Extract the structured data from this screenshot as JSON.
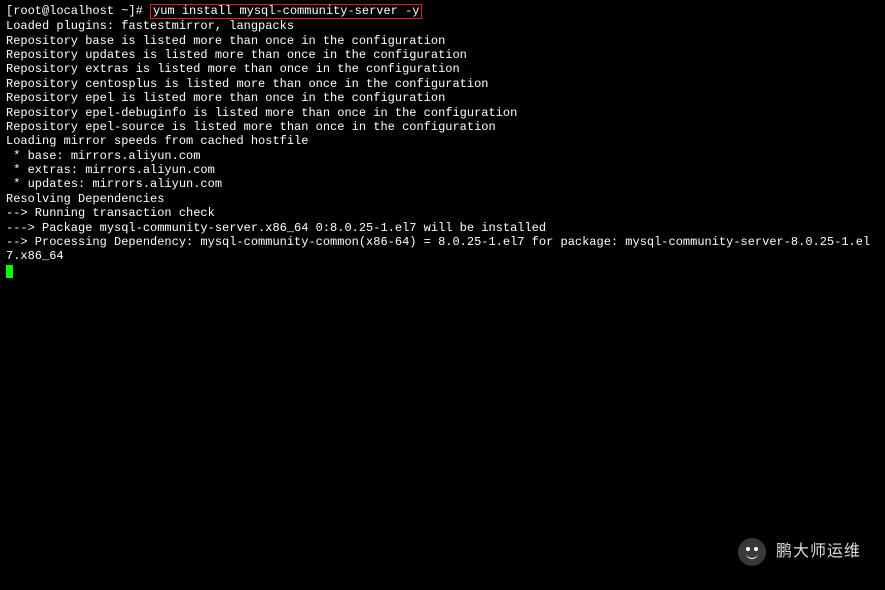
{
  "prompt": {
    "prefix": "[root@localhost ~]# ",
    "command": "yum install mysql-community-server -y"
  },
  "lines": [
    "Loaded plugins: fastestmirror, langpacks",
    "Repository base is listed more than once in the configuration",
    "Repository updates is listed more than once in the configuration",
    "Repository extras is listed more than once in the configuration",
    "Repository centosplus is listed more than once in the configuration",
    "Repository epel is listed more than once in the configuration",
    "Repository epel-debuginfo is listed more than once in the configuration",
    "Repository epel-source is listed more than once in the configuration",
    "Loading mirror speeds from cached hostfile",
    " * base: mirrors.aliyun.com",
    " * extras: mirrors.aliyun.com",
    " * updates: mirrors.aliyun.com",
    "Resolving Dependencies",
    "--> Running transaction check",
    "---> Package mysql-community-server.x86_64 0:8.0.25-1.el7 will be installed",
    "--> Processing Dependency: mysql-community-common(x86-64) = 8.0.25-1.el7 for package: mysql-community-server-8.0.25-1.el7.x86_64"
  ],
  "watermark": {
    "text": "鹏大师运维"
  }
}
